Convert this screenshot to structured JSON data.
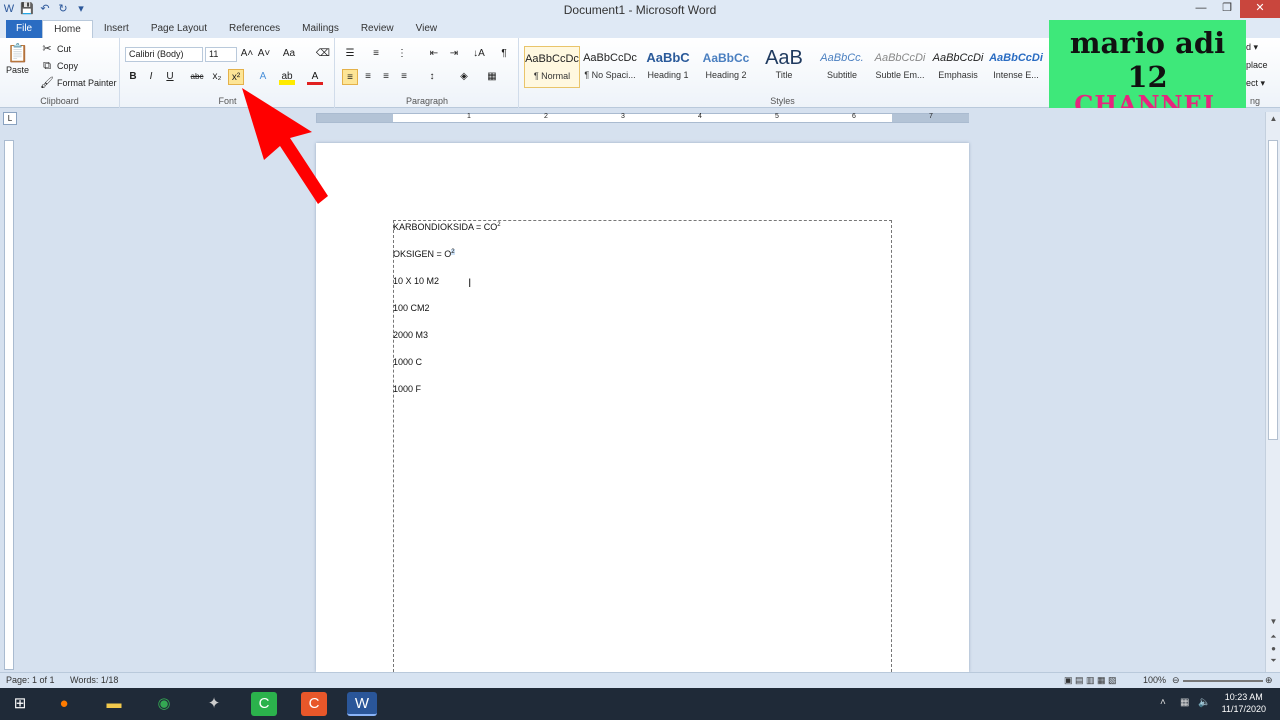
{
  "window": {
    "title": "Document1 - Microsoft Word",
    "controls": [
      "—",
      "❐",
      "✕"
    ]
  },
  "quick_access": [
    "W",
    "💾",
    "↶",
    "↻",
    "▾"
  ],
  "tabs": [
    {
      "label": "File"
    },
    {
      "label": "Home"
    },
    {
      "label": "Insert"
    },
    {
      "label": "Page Layout"
    },
    {
      "label": "References"
    },
    {
      "label": "Mailings"
    },
    {
      "label": "Review"
    },
    {
      "label": "View"
    }
  ],
  "clipboard": {
    "paste": "Paste",
    "cut": "Cut",
    "copy": "Copy",
    "format_painter": "Format Painter",
    "label": "Clipboard"
  },
  "font": {
    "name": "Calibri (Body)",
    "size": "11",
    "label": "Font",
    "bold": "B",
    "italic": "I",
    "underline": "U",
    "strike": "abc",
    "subscript": "x₂",
    "superscript": "x²",
    "grow": "A˄",
    "shrink": "A˅",
    "change_case": "Aa",
    "font_color": "A",
    "highlight": "ab",
    "effects": "A"
  },
  "paragraph": {
    "label": "Paragraph",
    "pilcrow": "¶",
    "sort": "↓A"
  },
  "styles": {
    "label": "Styles",
    "items": [
      {
        "sample": "AaBbCcDc",
        "name": "¶ Normal"
      },
      {
        "sample": "AaBbCcDc",
        "name": "¶ No Spaci..."
      },
      {
        "sample": "AaBbC",
        "name": "Heading 1"
      },
      {
        "sample": "AaBbCc",
        "name": "Heading 2"
      },
      {
        "sample": "AaB",
        "name": "Title"
      },
      {
        "sample": "AaBbCc.",
        "name": "Subtitle"
      },
      {
        "sample": "AaBbCcDi",
        "name": "Subtle Em..."
      },
      {
        "sample": "AaBbCcDi",
        "name": "Emphasis"
      },
      {
        "sample": "AaBbCcDi",
        "name": "Intense E..."
      }
    ],
    "editing_fragments": [
      "d ▾",
      "place",
      "ect ▾",
      "ng"
    ]
  },
  "logo": {
    "line1": "mario adi 12",
    "line2": "CHANNEL"
  },
  "document": {
    "lines": [
      {
        "text": "KARBONDIOKSIDA = CO",
        "sup": "2"
      },
      {
        "text": "OKSIGEN = O",
        "sup": "2"
      },
      {
        "text": "10 X 10 M2",
        "sup": ""
      },
      {
        "text": "100  CM2",
        "sup": ""
      },
      {
        "text": "2000  M3",
        "sup": ""
      },
      {
        "text": "1000  C",
        "sup": ""
      },
      {
        "text": "1000  F",
        "sup": ""
      }
    ]
  },
  "ruler_numbers": [
    "1",
    "2",
    "3",
    "4",
    "5",
    "6",
    "7"
  ],
  "status": {
    "page": "Page: 1 of 1",
    "words": "Words: 1/18",
    "zoom": "100%"
  },
  "taskbar": {
    "time": "10:23 AM",
    "date": "11/17/2020"
  },
  "colors": {
    "accent": "#2a6cc2",
    "logo_bg": "#3ee87a",
    "logo_text2": "#e8257f",
    "arrow": "#ff0000"
  }
}
